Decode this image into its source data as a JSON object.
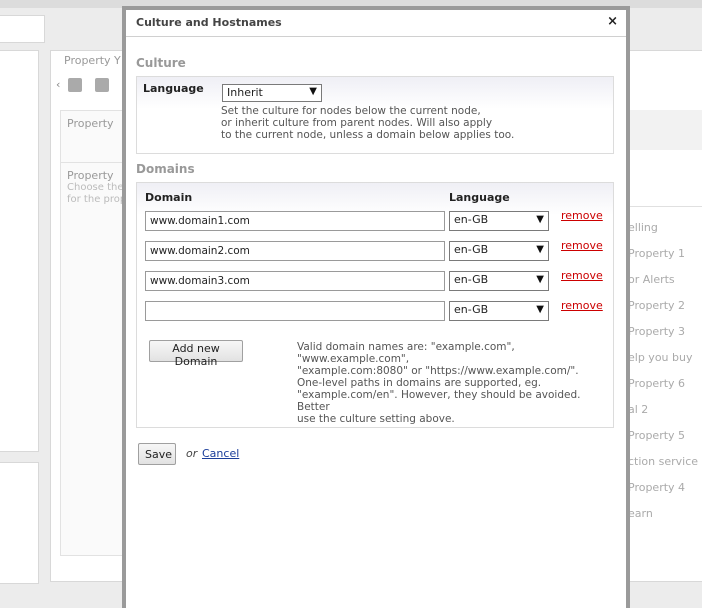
{
  "background": {
    "property_tab": "Property Y",
    "property_box1": "Property",
    "property_box2_title": "Property",
    "property_box2_sub": "Choose the",
    "property_box2_sub2": "for the prop",
    "right_list": [
      "elling",
      "Property 1",
      "or Alerts",
      "Property 2",
      "Property 3",
      "elp you buy",
      "Property 6",
      "al 2",
      "Property 5",
      "ction service",
      "Property 4",
      "earn"
    ]
  },
  "modal": {
    "title": "Culture and Hostnames",
    "close_label": "×",
    "culture": {
      "heading": "Culture",
      "language_label": "Language",
      "language_value": "Inherit",
      "help_line1": "Set the culture for nodes below the current node,",
      "help_line2": "or inherit culture from parent nodes. Will also apply",
      "help_line3": "to the current node, unless a domain below applies too."
    },
    "domains": {
      "heading": "Domains",
      "col_domain": "Domain",
      "col_language": "Language",
      "rows": [
        {
          "domain": "www.domain1.com",
          "language": "en-GB",
          "remove": "remove"
        },
        {
          "domain": "www.domain2.com",
          "language": "en-GB",
          "remove": "remove"
        },
        {
          "domain": "www.domain3.com",
          "language": "en-GB",
          "remove": "remove"
        },
        {
          "domain": "",
          "language": "en-GB",
          "remove": "remove"
        }
      ],
      "add_button": "Add new Domain",
      "help1_line1": "Valid domain names are: \"example.com\", \"www.example.com\",",
      "help1_line2": "\"example.com:8080\" or \"https://www.example.com/\".",
      "help2_line1": "One-level paths in domains are supported, eg.",
      "help2_line2": "\"example.com/en\". However, they should be avoided. Better",
      "help2_line3": "use the culture setting above."
    },
    "footer": {
      "save": "Save",
      "or": "or",
      "cancel": "Cancel"
    }
  }
}
